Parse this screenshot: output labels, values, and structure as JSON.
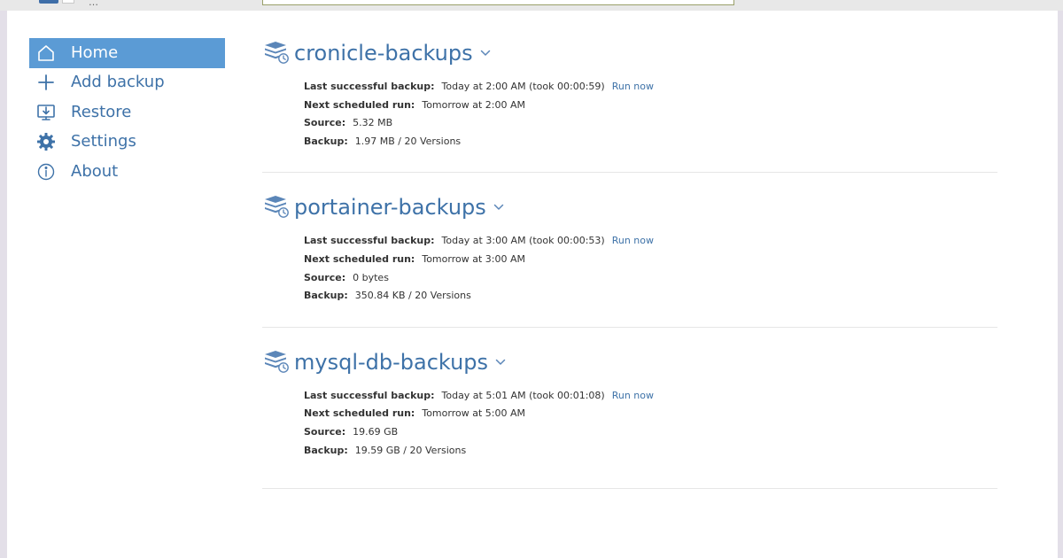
{
  "app": {
    "brand_text": "…"
  },
  "sidebar": {
    "items": [
      {
        "label": "Home",
        "icon": "home-icon",
        "active": true
      },
      {
        "label": "Add backup",
        "icon": "plus-icon",
        "active": false
      },
      {
        "label": "Restore",
        "icon": "restore-icon",
        "active": false
      },
      {
        "label": "Settings",
        "icon": "gear-icon",
        "active": false
      },
      {
        "label": "About",
        "icon": "info-icon",
        "active": false
      }
    ]
  },
  "labels": {
    "last_success": "Last successful backup:",
    "next_run": "Next scheduled run:",
    "source": "Source:",
    "backup": "Backup:",
    "run_now": "Run now"
  },
  "jobs": [
    {
      "name": "cronicle-backups",
      "last_success": "Today at 2:00 AM (took 00:00:59)",
      "next_run": "Tomorrow at 2:00 AM",
      "source": "5.32 MB",
      "backup": "1.97 MB / 20 Versions"
    },
    {
      "name": "portainer-backups",
      "last_success": "Today at 3:00 AM (took 00:00:53)",
      "next_run": "Tomorrow at 3:00 AM",
      "source": "0 bytes",
      "backup": "350.84 KB / 20 Versions"
    },
    {
      "name": "mysql-db-backups",
      "last_success": "Today at 5:01 AM (took 00:01:08)",
      "next_run": "Tomorrow at 5:00 AM",
      "source": "19.69 GB",
      "backup": "19.59 GB / 20 Versions"
    }
  ],
  "colors": {
    "accent": "#3e72a8",
    "active_nav": "#5b9bd5"
  }
}
